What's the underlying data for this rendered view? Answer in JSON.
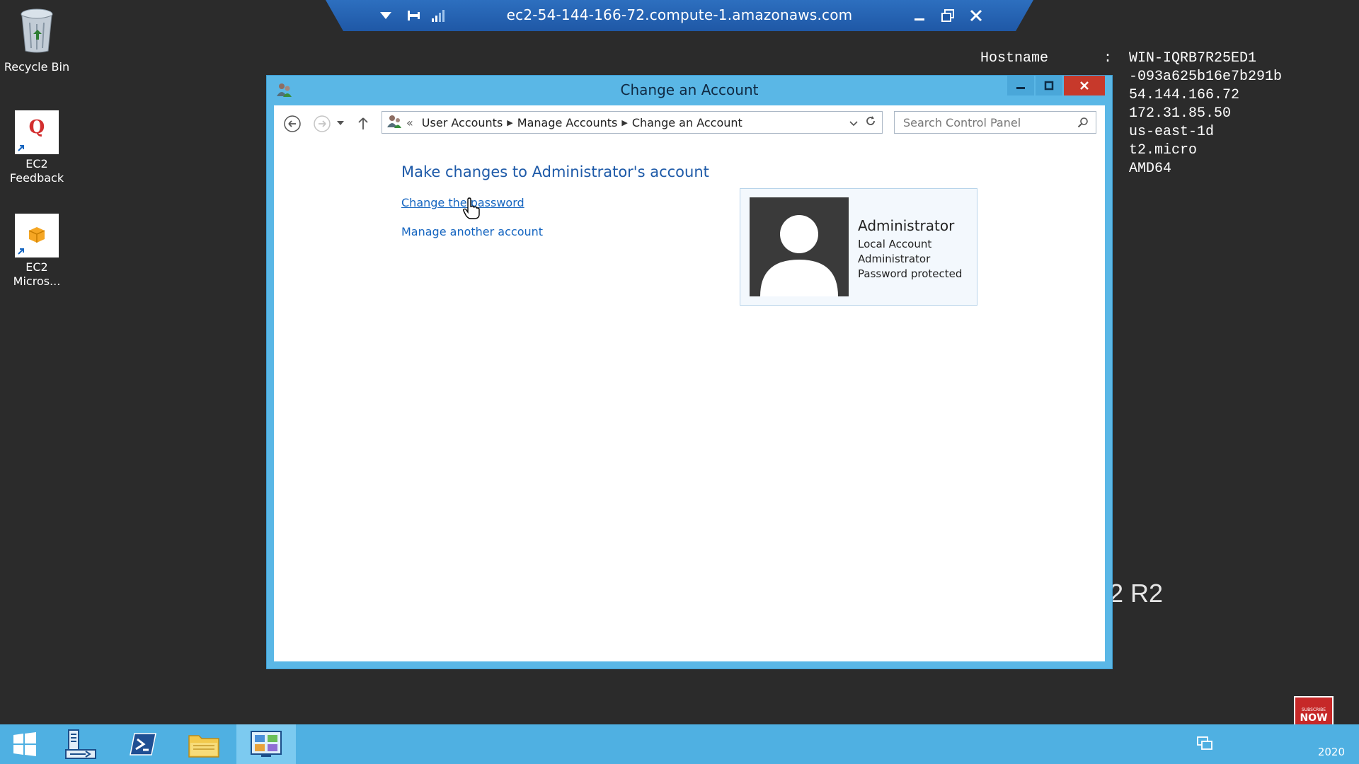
{
  "rdp_bar": {
    "host": "ec2-54-144-166-72.compute-1.amazonaws.com"
  },
  "desktop": {
    "icons": [
      {
        "label": "Recycle Bin"
      },
      {
        "label": "EC2\nFeedback"
      },
      {
        "label": "EC2\nMicros..."
      }
    ],
    "bginfo": {
      "hostname_label": "Hostname",
      "hostname_value": "WIN-IQRB7R25ED1",
      "line2": "-093a625b16e7b291b",
      "line3": "54.144.166.72",
      "line4": "172.31.85.50",
      "line5": "us-east-1d",
      "line6": "t2.micro",
      "line7": "AMD64"
    },
    "os_suffix": "2 R2"
  },
  "window": {
    "title": "Change an Account",
    "breadcrumb": [
      "User Accounts",
      "Manage Accounts",
      "Change an Account"
    ],
    "breadcrumb_overflow": "«",
    "search_placeholder": "Search Control Panel",
    "heading": "Make changes to Administrator's account",
    "links": {
      "change_password": "Change the password",
      "manage_another": "Manage another account"
    },
    "account": {
      "name": "Administrator",
      "type": "Local Account",
      "group": "Administrator",
      "status": "Password protected"
    }
  },
  "taskbar": {
    "year": "2020",
    "subscribe_small": "SUBSCRIBE",
    "subscribe_now": "NOW"
  },
  "colors": {
    "window_frame": "#5ab7e6",
    "link": "#1565c0",
    "heading": "#1e5aa8",
    "taskbar": "#4fb0e2"
  }
}
